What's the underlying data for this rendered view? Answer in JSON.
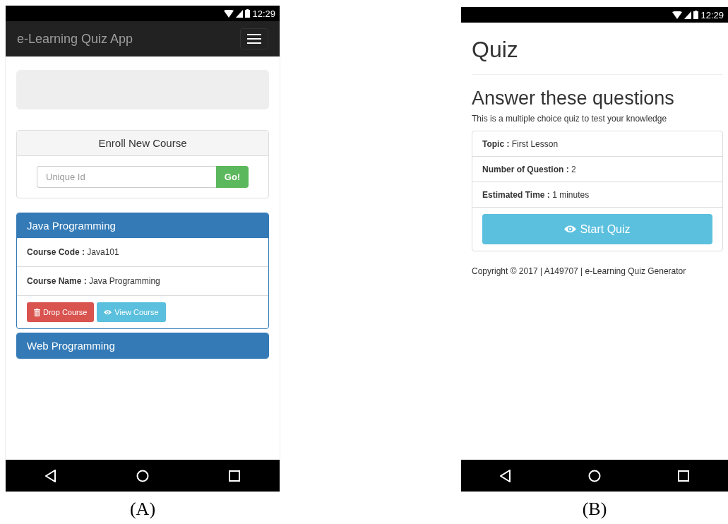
{
  "panels": [
    {
      "kind": "courses",
      "label": "(A)",
      "time": "12:29",
      "app_title": "e-Learning Quiz App",
      "enroll": {
        "title": "Enroll New Course",
        "placeholder": "Unique Id",
        "button": "Go!"
      },
      "courses": [
        {
          "title": "Java Programming",
          "expanded": true,
          "fields": [
            "**Course Code :** Java101",
            "**Course Name :** Java Programming"
          ],
          "actions": [
            {
              "kind": "danger",
              "label": "Drop Course"
            },
            {
              "kind": "info",
              "label": "View Course"
            }
          ]
        },
        {
          "title": "Web Programming",
          "expanded": false
        }
      ]
    },
    {
      "kind": "quiz",
      "label": "(B)",
      "time": "12:29",
      "title": "Quiz",
      "heading": "Answer these questions",
      "intro": "This is a multiple choice quiz to test your knowledge",
      "items": [
        "**Topic :** First Lesson",
        "**Number of Question :** 2",
        "**Estimated Time :** 1 minutes"
      ],
      "start": "Start Quiz",
      "footer": "Copyright © 2017 | A149707 | e-Learning Quiz Generator"
    }
  ]
}
